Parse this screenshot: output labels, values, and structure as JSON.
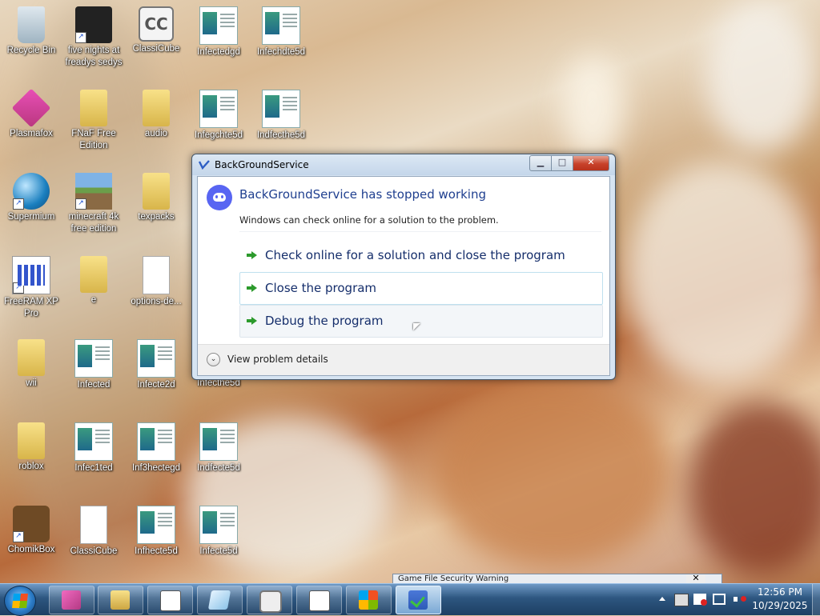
{
  "desktop": {
    "icons": [
      {
        "label": "Recycle Bin",
        "icon": "recycle-bin-icon"
      },
      {
        "label": "five nights at freadys sedys",
        "icon": "app-shortcut-icon"
      },
      {
        "label": "ClassiCube",
        "icon": "classicube-icon"
      },
      {
        "label": "Infectedgd",
        "icon": "window-app-icon"
      },
      {
        "label": "Infechdte5d",
        "icon": "window-app-icon"
      },
      {
        "label": "Plasmafox",
        "icon": "plasmafox-icon"
      },
      {
        "label": "FNaF Free Edition",
        "icon": "folder-icon"
      },
      {
        "label": "audio",
        "icon": "folder-icon"
      },
      {
        "label": "Infegchte5d",
        "icon": "window-app-icon"
      },
      {
        "label": "Indfecthe5d",
        "icon": "window-app-icon"
      },
      {
        "label": "Supermium",
        "icon": "browser-globe-icon"
      },
      {
        "label": "minecraft 4k free edition",
        "icon": "minecraft-icon"
      },
      {
        "label": "texpacks",
        "icon": "folder-icon"
      },
      {
        "label": "FreeRAM XP Pro",
        "icon": "ram-tool-icon"
      },
      {
        "label": "e",
        "icon": "folder-icon"
      },
      {
        "label": "options-de...",
        "icon": "text-file-icon"
      },
      {
        "label": "wii",
        "icon": "folder-icon"
      },
      {
        "label": "Infected",
        "icon": "window-app-icon"
      },
      {
        "label": "Infecte2d",
        "icon": "window-app-icon"
      },
      {
        "label": "Infecthe5d",
        "icon": "window-app-icon"
      },
      {
        "label": "roblox",
        "icon": "folder-icon"
      },
      {
        "label": "Infec1ted",
        "icon": "window-app-icon"
      },
      {
        "label": "Inf3hectegd",
        "icon": "window-app-icon"
      },
      {
        "label": "Indfecte5d",
        "icon": "window-app-icon"
      },
      {
        "label": "ChomikBox",
        "icon": "chomikbox-icon"
      },
      {
        "label": "ClassiCube",
        "icon": "blank-file-icon"
      },
      {
        "label": "Infhecte5d",
        "icon": "window-app-icon"
      },
      {
        "label": "Infecte5d",
        "icon": "window-app-icon"
      }
    ]
  },
  "dialog": {
    "title": "BackGroundService",
    "main_message": "BackGroundService has stopped working",
    "sub_message": "Windows can check online for a solution to the problem.",
    "options": [
      "Check online for a solution and close the program",
      "Close the program",
      "Debug the program"
    ],
    "details_label": "View problem details",
    "min_glyph": "▁",
    "max_glyph": "□",
    "close_glyph": "✕",
    "chevron_glyph": "⌄"
  },
  "background_window": {
    "title": "Game File Security Warning",
    "close_glyph": "✕"
  },
  "taskbar": {
    "buttons": [
      {
        "icon": "plasmafox-icon",
        "active": false
      },
      {
        "icon": "file-explorer-icon",
        "active": false
      },
      {
        "icon": "window-app-icon",
        "active": false
      },
      {
        "icon": "glass-app-icon",
        "active": false
      },
      {
        "icon": "classicube-icon",
        "active": false
      },
      {
        "icon": "window-app-icon",
        "active": false
      },
      {
        "icon": "windows-logo-icon",
        "active": false
      },
      {
        "icon": "checkmark-app-icon",
        "active": true
      }
    ],
    "tray": {
      "time": "12:56 PM",
      "date": "10/29/2025"
    }
  }
}
